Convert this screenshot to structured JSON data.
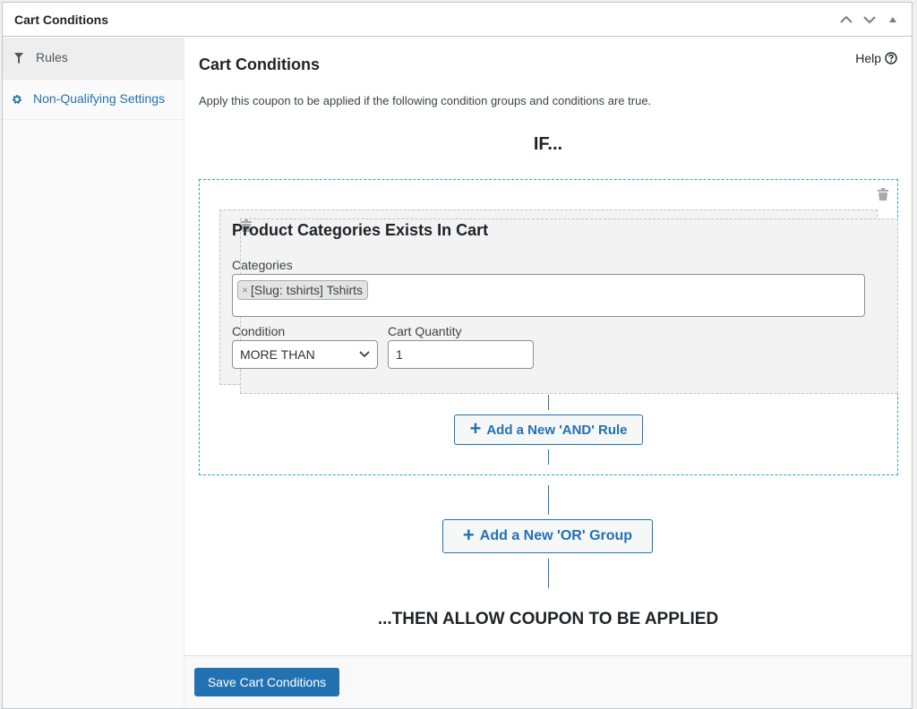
{
  "postbox": {
    "title": "Cart Conditions",
    "actions": [
      {
        "name": "move-up",
        "icon": "chevron-up-icon"
      },
      {
        "name": "move-down",
        "icon": "chevron-down-icon"
      },
      {
        "name": "toggle",
        "icon": "triangle-up-icon"
      }
    ]
  },
  "tabs": [
    {
      "label": "Rules",
      "icon": "filter-icon",
      "active": true
    },
    {
      "label": "Non-Qualifying Settings",
      "icon": "gear-icon",
      "active": false
    }
  ],
  "panel": {
    "title": "Cart Conditions",
    "help_label": "Help",
    "description": "Apply this coupon to be applied if the following condition groups and conditions are true.",
    "if_label": "IF...",
    "then_label": "...THEN ALLOW COUPON TO BE APPLIED"
  },
  "rule": {
    "title": "Product Categories Exists In Cart",
    "categories_label": "Categories",
    "selected_categories": [
      "[Slug: tshirts] Tshirts"
    ],
    "condition_label": "Condition",
    "condition_value": "MORE THAN",
    "quantity_label": "Cart Quantity",
    "quantity_value": "1"
  },
  "buttons": {
    "add_and": "Add a New 'AND' Rule",
    "add_or": "Add a New 'OR' Group",
    "save": "Save Cart Conditions"
  },
  "colors": {
    "accent": "#2271b1",
    "group_border": "#2ea2cc"
  }
}
